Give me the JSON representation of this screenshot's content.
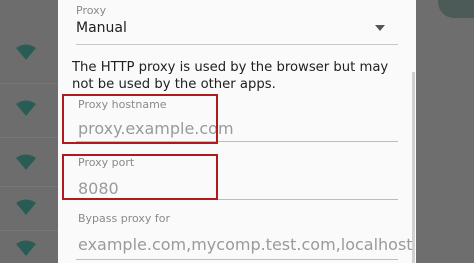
{
  "proxy": {
    "label": "Proxy",
    "value": "Manual"
  },
  "info_text": "The HTTP proxy is used by the browser but may not be used by the other apps.",
  "hostname": {
    "label": "Proxy hostname",
    "placeholder": "proxy.example.com"
  },
  "port": {
    "label": "Proxy port",
    "placeholder": "8080"
  },
  "bypass": {
    "label": "Bypass proxy for",
    "placeholder": "example.com,mycomp.test.com,localhost"
  },
  "colors": {
    "highlight": "#b01a1f",
    "wifi_icon": "#2a5c56"
  },
  "icons": [
    "wifi-icon",
    "dropdown-arrow-icon"
  ]
}
